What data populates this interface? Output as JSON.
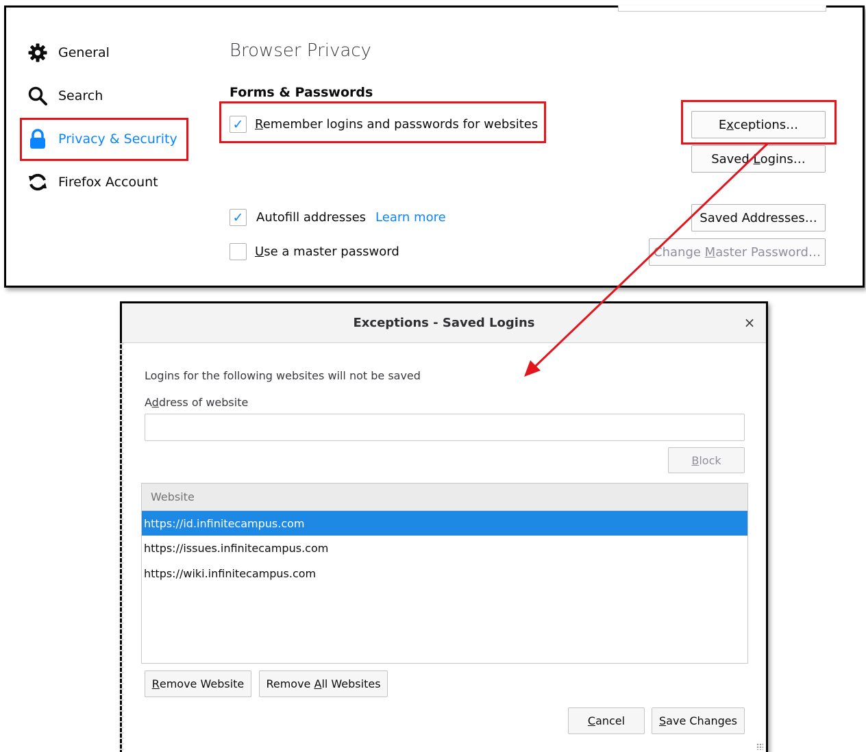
{
  "prefs": {
    "nav": [
      {
        "label": "General",
        "icon": "gear-icon"
      },
      {
        "label": "Search",
        "icon": "search-icon"
      },
      {
        "label": "Privacy & Security",
        "icon": "lock-icon",
        "active": true
      },
      {
        "label": "Firefox Account",
        "icon": "sync-icon"
      }
    ],
    "heading": "Browser Privacy",
    "subheading": "Forms & Passwords",
    "remember_logins": {
      "prefix": "R",
      "rest": "emember logins and passwords for websites",
      "checked": true
    },
    "autofill": {
      "label": "Autofill addresses",
      "link": "Learn more",
      "checked": true
    },
    "master_password": {
      "prefix": "U",
      "rest": "se a master password",
      "checked": false
    },
    "buttons": {
      "exceptions": {
        "pre": "E",
        "u": "x",
        "post": "ceptions…"
      },
      "saved_logins": {
        "pre": "Saved ",
        "u": "L",
        "post": "ogins…"
      },
      "saved_addresses": "Saved Addresses…",
      "change_master": {
        "pre": "Change ",
        "u": "M",
        "post": "aster Password…"
      }
    }
  },
  "dialog": {
    "title": "Exceptions - Saved Logins",
    "close_glyph": "×",
    "description": "Logins for the following websites will not be saved",
    "address_label": {
      "pre": "A",
      "u": "d",
      "post": "dress of website"
    },
    "block_button": {
      "u": "B",
      "post": "lock"
    },
    "column_header": "Website",
    "sites": [
      "https://id.infinitecampus.com",
      "https://issues.infinitecampus.com",
      "https://wiki.infinitecampus.com"
    ],
    "remove_website": {
      "u": "R",
      "post": "emove Website"
    },
    "remove_all": {
      "pre": "Remove ",
      "u": "A",
      "post": "ll Websites"
    },
    "cancel": {
      "u": "C",
      "post": "ancel"
    },
    "save_changes": {
      "u": "S",
      "post": "ave Changes"
    }
  },
  "colors": {
    "accent": "#0a84ff",
    "annotation": "#e2151c",
    "selection": "#1e88e5"
  }
}
